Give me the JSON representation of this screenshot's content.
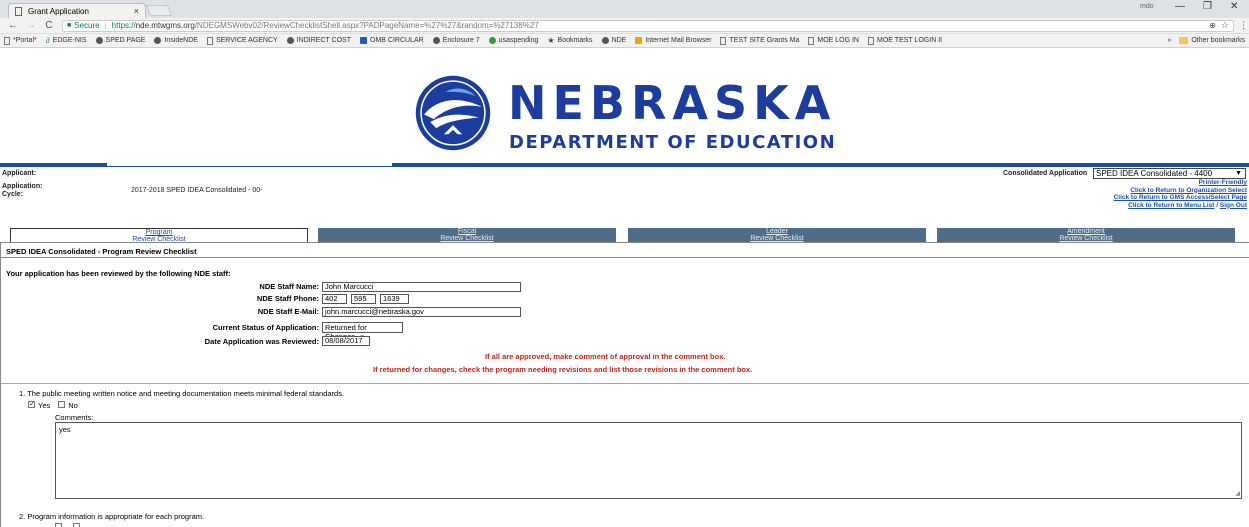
{
  "browser": {
    "tab_title": "Grant Application",
    "tab_close": "×",
    "window_user": "mdo",
    "window_controls": [
      "—",
      "❐",
      "✕"
    ],
    "url_secure": "Secure",
    "url_protocol": "https://",
    "url_host": "nde.mtwgms.org",
    "url_path": "/NDEGMSWebv02/ReviewChecklistShell.aspx?PADPageName=%27%27&random=%27138%27",
    "bookmarks": [
      {
        "label": "*Portal*",
        "icon": "page-icon"
      },
      {
        "label": "EDGE-NIS",
        "icon": "link-icon"
      },
      {
        "label": "SPED PAGE",
        "icon": "globe-icon"
      },
      {
        "label": "InsideNDE",
        "icon": "globe-icon"
      },
      {
        "label": "SERVICE AGENCY",
        "icon": "page-icon"
      },
      {
        "label": "INDIRECT COST",
        "icon": "globe-icon"
      },
      {
        "label": "OMB CIRCULAR",
        "icon": "blue-icon"
      },
      {
        "label": "Enclosure 7",
        "icon": "globe-icon"
      },
      {
        "label": "usaspending",
        "icon": "green-icon"
      },
      {
        "label": "Bookmarks",
        "icon": "star-icon"
      },
      {
        "label": "NDE",
        "icon": "globe-icon"
      },
      {
        "label": "Internet Mail Browser",
        "icon": "orange-icon"
      },
      {
        "label": "TEST SITE Grants Ma",
        "icon": "page-icon"
      },
      {
        "label": "MOE LOG IN",
        "icon": "page-icon"
      },
      {
        "label": "MOE TEST LOGIN II",
        "icon": "page-icon"
      }
    ],
    "overflow": "»",
    "other_bookmarks": "Other bookmarks"
  },
  "header": {
    "title": "NEBRASKA",
    "subtitle": "DEPARTMENT OF EDUCATION",
    "brand_color": "#1c3d9d"
  },
  "info": {
    "applicant_label": "Applicant:",
    "application_label": "Application:",
    "cycle_label": "Cycle:",
    "cycle_value": "2017-2018 SPED IDEA Consolidated - 00-",
    "consolidated_label": "Consolidated Application",
    "consolidated_value": "SPED IDEA Consolidated - 4400",
    "links": {
      "printer": "Printer-Friendly",
      "org": "Click to Return to Organization Select",
      "gms": "Click to Return to GMS Access/Select Page",
      "menu": "Click to Return to Menu List",
      "signout": "Sign Out"
    }
  },
  "tabs": [
    {
      "line1": "Program",
      "line2": "Review Checklist"
    },
    {
      "line1": "Fiscal",
      "line2": "Review Checklist"
    },
    {
      "line1": "Leader",
      "line2": "Review Checklist"
    },
    {
      "line1": "Amendment",
      "line2": "Review Checklist"
    }
  ],
  "page": {
    "heading": "SPED IDEA Consolidated - Program Review Checklist",
    "reviewed_text": "Your application has been reviewed by the following NDE staff:",
    "staff_name_label": "NDE Staff Name:",
    "staff_name": "John Marcucci",
    "staff_phone_label": "NDE Staff Phone:",
    "phone_area": "402",
    "phone_prefix": "595",
    "phone_line": "1639",
    "staff_email_label": "NDE Staff E-Mail:",
    "staff_email": "john.marcucci@nebraska.gov",
    "status_label": "Current Status of Application:",
    "status_value": "Returned for Changes",
    "date_label": "Date Application was Reviewed:",
    "date_value": "08/08/2017",
    "note1": "If all are approved, make comment of approval in the comment box.",
    "note2": "If returned for changes, check the program needing revisions and list those revisions in the comment box."
  },
  "questions": [
    {
      "text": "1. The public meeting written notice and meeting documentation meets minimal federal standards.",
      "yes_label": "Yes",
      "no_label": "No",
      "yes_checked": true,
      "no_checked": false,
      "comments_label": "Comments:",
      "comment": "yes"
    },
    {
      "text": "2. Program information is appropriate for each program."
    }
  ]
}
